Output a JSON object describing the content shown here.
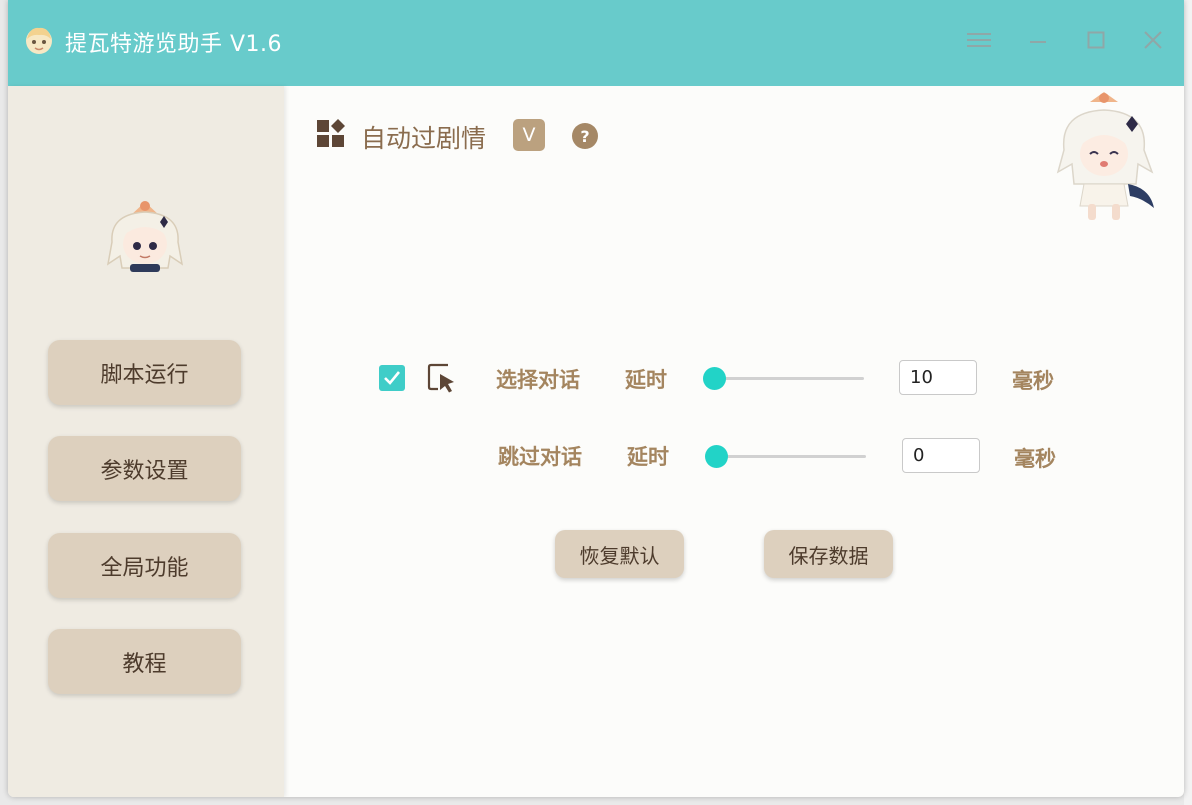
{
  "window": {
    "title": "提瓦特游览助手 V1.6",
    "accent_color": "#68cbcb",
    "controls": [
      "menu-icon",
      "minimize-icon",
      "maximize-icon",
      "close-icon"
    ]
  },
  "sidebar": {
    "items": [
      {
        "label": "脚本运行"
      },
      {
        "label": "参数设置"
      },
      {
        "label": "全局功能"
      },
      {
        "label": "教程"
      }
    ]
  },
  "main": {
    "title": "自动过剧情",
    "badge": "V",
    "help": "?",
    "rows": [
      {
        "checked": true,
        "label": "选择对话",
        "delay_label": "延时",
        "slider_value": 0,
        "value": "10",
        "unit": "毫秒"
      },
      {
        "label": "跳过对话",
        "delay_label": "延时",
        "slider_value": 0,
        "value": "0",
        "unit": "毫秒"
      }
    ],
    "buttons": {
      "reset": "恢复默认",
      "save": "保存数据"
    }
  }
}
